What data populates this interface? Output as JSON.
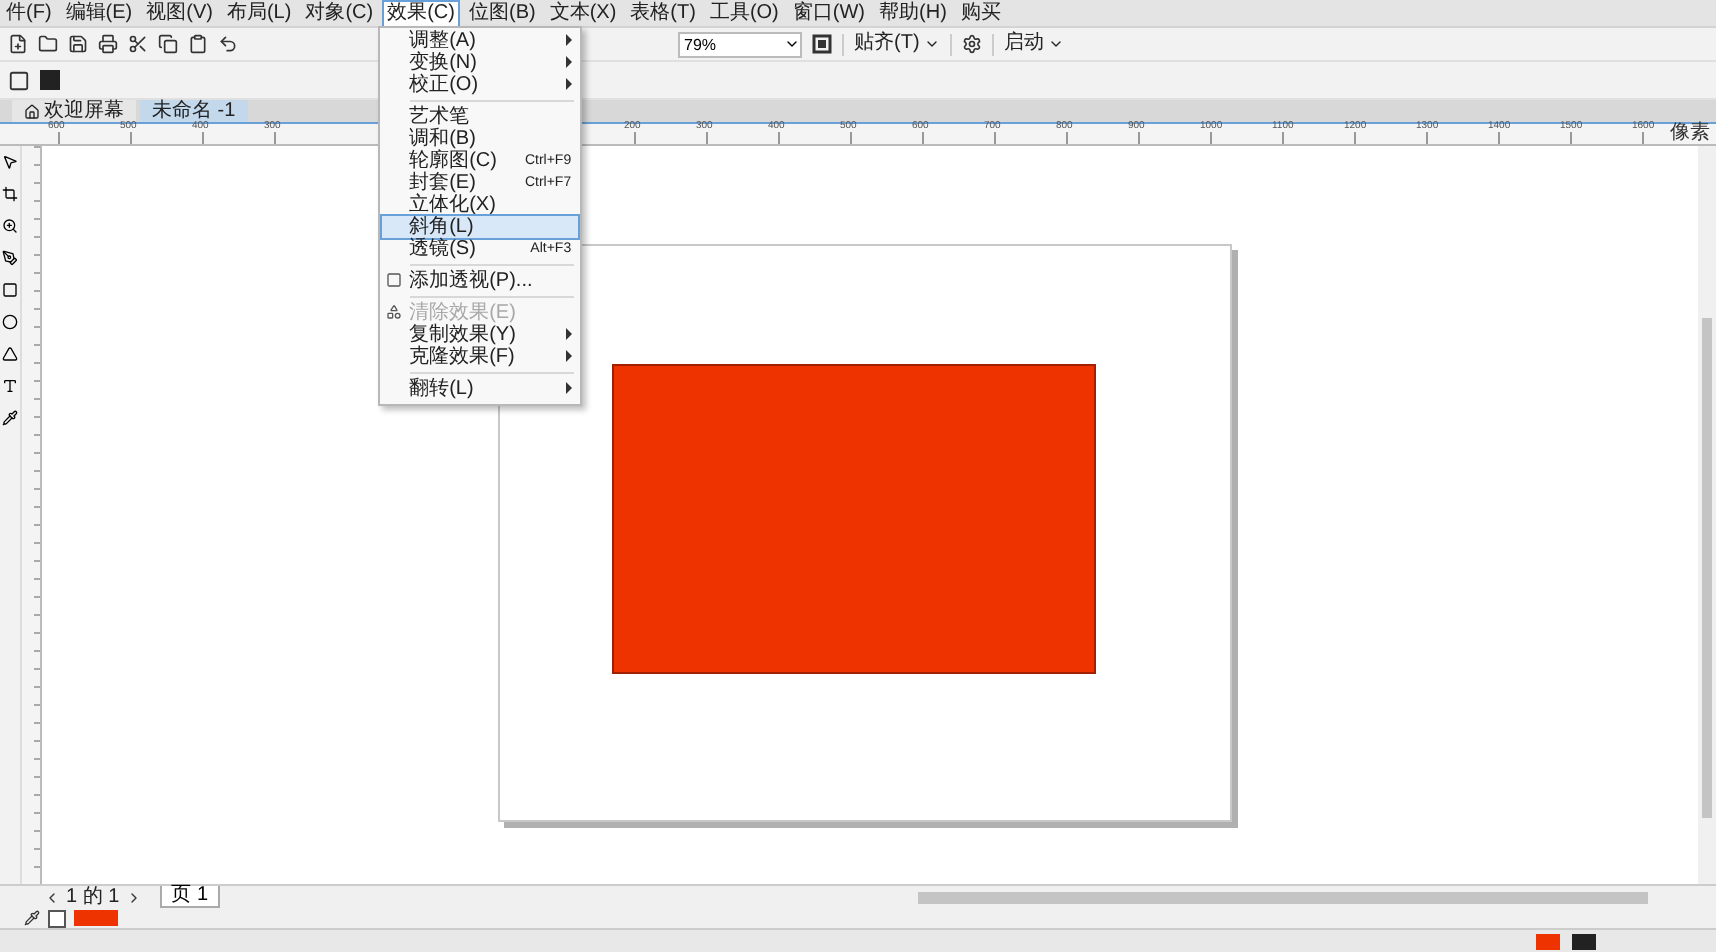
{
  "menu_bar": [
    {
      "label": "件(F)",
      "selected": false
    },
    {
      "label": "编辑(E)",
      "selected": false
    },
    {
      "label": "视图(V)",
      "selected": false
    },
    {
      "label": "布局(L)",
      "selected": false
    },
    {
      "label": "对象(C)",
      "selected": false
    },
    {
      "label": "效果(C)",
      "selected": true
    },
    {
      "label": "位图(B)",
      "selected": false
    },
    {
      "label": "文本(X)",
      "selected": false
    },
    {
      "label": "表格(T)",
      "selected": false
    },
    {
      "label": "工具(O)",
      "selected": false
    },
    {
      "label": "窗口(W)",
      "selected": false
    },
    {
      "label": "帮助(H)",
      "selected": false
    },
    {
      "label": "购买",
      "selected": false
    }
  ],
  "effects_menu": [
    {
      "kind": "item",
      "label": "调整(A)",
      "submenu": true,
      "selected": false,
      "disabled": false
    },
    {
      "kind": "item",
      "label": "变换(N)",
      "submenu": true,
      "selected": false,
      "disabled": false
    },
    {
      "kind": "item",
      "label": "校正(O)",
      "submenu": true,
      "selected": false,
      "disabled": false
    },
    {
      "kind": "separator"
    },
    {
      "kind": "item",
      "label": "艺术笔",
      "submenu": false,
      "selected": false,
      "disabled": false
    },
    {
      "kind": "item",
      "label": "调和(B)",
      "submenu": false,
      "selected": false,
      "disabled": false
    },
    {
      "kind": "item",
      "label": "轮廓图(C)",
      "shortcut": "Ctrl+F9",
      "submenu": false,
      "selected": false,
      "disabled": false
    },
    {
      "kind": "item",
      "label": "封套(E)",
      "shortcut": "Ctrl+F7",
      "submenu": false,
      "selected": false,
      "disabled": false
    },
    {
      "kind": "item",
      "label": "立体化(X)",
      "submenu": false,
      "selected": false,
      "disabled": false
    },
    {
      "kind": "item",
      "label": "斜角(L)",
      "submenu": false,
      "selected": true,
      "disabled": false
    },
    {
      "kind": "item",
      "label": "透镜(S)",
      "shortcut": "Alt+F3",
      "submenu": false,
      "selected": false,
      "disabled": false
    },
    {
      "kind": "separator"
    },
    {
      "kind": "item",
      "label": "添加透视(P)...",
      "submenu": false,
      "selected": false,
      "disabled": false
    },
    {
      "kind": "separator"
    },
    {
      "kind": "item",
      "label": "清除效果(E)",
      "submenu": false,
      "selected": false,
      "disabled": true
    },
    {
      "kind": "item",
      "label": "复制效果(Y)",
      "submenu": true,
      "selected": false,
      "disabled": false
    },
    {
      "kind": "item",
      "label": "克隆效果(F)",
      "submenu": true,
      "selected": false,
      "disabled": false
    },
    {
      "kind": "separator"
    },
    {
      "kind": "item",
      "label": "翻转(L)",
      "submenu": true,
      "selected": false,
      "disabled": false
    }
  ],
  "toolbar": {
    "zoom": "79%",
    "snap": "贴齐(T)",
    "launch": "启动"
  },
  "doc_tabs": [
    {
      "label": "欢迎屏幕",
      "selected": false
    },
    {
      "label": "未命名 -1",
      "selected": true
    }
  ],
  "ruler": {
    "left_labels": [
      "600",
      "500",
      "400",
      "300"
    ],
    "right_labels": [
      "200",
      "300",
      "400",
      "500",
      "600",
      "700",
      "800",
      "900",
      "1000",
      "1100",
      "1200",
      "1300",
      "1400",
      "1500",
      "1600"
    ],
    "unit": "像素"
  },
  "page_nav": {
    "position": "1 的 1",
    "tabs": [
      {
        "label": "页 1",
        "selected": true
      }
    ]
  }
}
